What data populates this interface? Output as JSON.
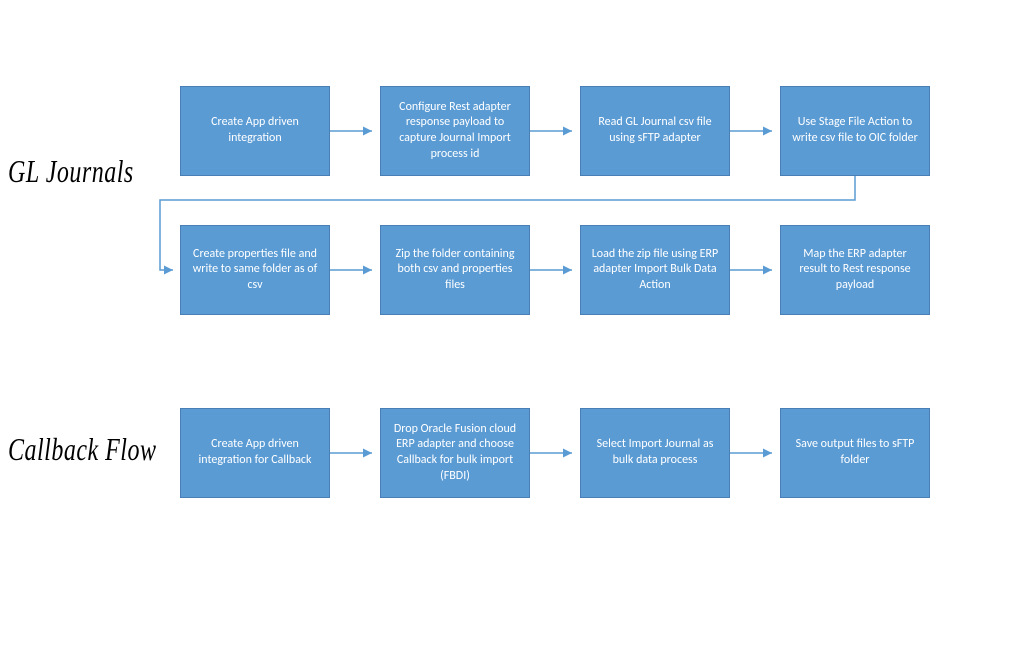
{
  "colors": {
    "box": "#5a9bd4",
    "arrow": "#5a9bd4"
  },
  "labels": {
    "section1": "GL Journals",
    "section2": "Callback Flow"
  },
  "row1": {
    "b1": "Create App driven integration",
    "b2": "Configure Rest adapter response payload to capture Journal Import process id",
    "b3": "Read GL Journal csv file using sFTP adapter",
    "b4": "Use Stage File Action to write csv file to OIC folder"
  },
  "row2": {
    "b1": "Create properties file and write to same folder as of csv",
    "b2": "Zip the folder containing both csv and properties files",
    "b3": "Load  the zip file using ERP adapter Import Bulk Data Action",
    "b4": "Map the ERP adapter result to Rest response payload"
  },
  "row3": {
    "b1": "Create App driven integration for Callback",
    "b2": "Drop Oracle Fusion cloud ERP adapter and choose Callback for bulk import (FBDI)",
    "b3": "Select Import Journal as bulk data process",
    "b4": "Save output files to sFTP folder"
  }
}
